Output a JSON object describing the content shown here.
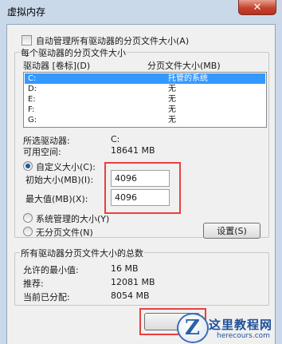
{
  "window": {
    "title": "虚拟内存",
    "close_glyph": "✕"
  },
  "auto_manage": {
    "label": "自动管理所有驱动器的分页文件大小(A)",
    "checked": false
  },
  "paging_group": {
    "legend": "每个驱动器的分页文件大小",
    "col_drive": "驱动器 [卷标](D)",
    "col_size": "分页文件大小(MB)",
    "rows": [
      {
        "drive": "C:",
        "size": "托管的系统",
        "selected": true
      },
      {
        "drive": "D:",
        "size": "无",
        "selected": false
      },
      {
        "drive": "E:",
        "size": "无",
        "selected": false
      },
      {
        "drive": "F:",
        "size": "无",
        "selected": false
      },
      {
        "drive": "G:",
        "size": "无",
        "selected": false
      }
    ],
    "selected_drive_label": "所选驱动器:",
    "selected_drive_value": "C:",
    "free_space_label": "可用空间:",
    "free_space_value": "18641 MB",
    "custom_size_label": "自定义大小(C):",
    "initial_size_label": "初始大小(MB)(I):",
    "initial_size_value": "4096",
    "max_size_label": "最大值(MB)(X):",
    "max_size_value": "4096",
    "system_managed_label": "系统管理的大小(Y)",
    "no_paging_label": "无分页文件(N)",
    "set_button": "设置(S)",
    "selected_option": "custom"
  },
  "totals_group": {
    "legend": "所有驱动器分页文件大小的总数",
    "min_allowed_label": "允许的最小值:",
    "min_allowed_value": "16 MB",
    "recommended_label": "推荐:",
    "recommended_value": "12081 MB",
    "current_label": "当前已分配:",
    "current_value": "8054 MB"
  },
  "watermark": {
    "name": "这里教程网",
    "url": "herecours.com"
  },
  "colors": {
    "highlight": "#e8403f",
    "selection": "#3399ff",
    "title_bar": "#c9d9ea"
  }
}
